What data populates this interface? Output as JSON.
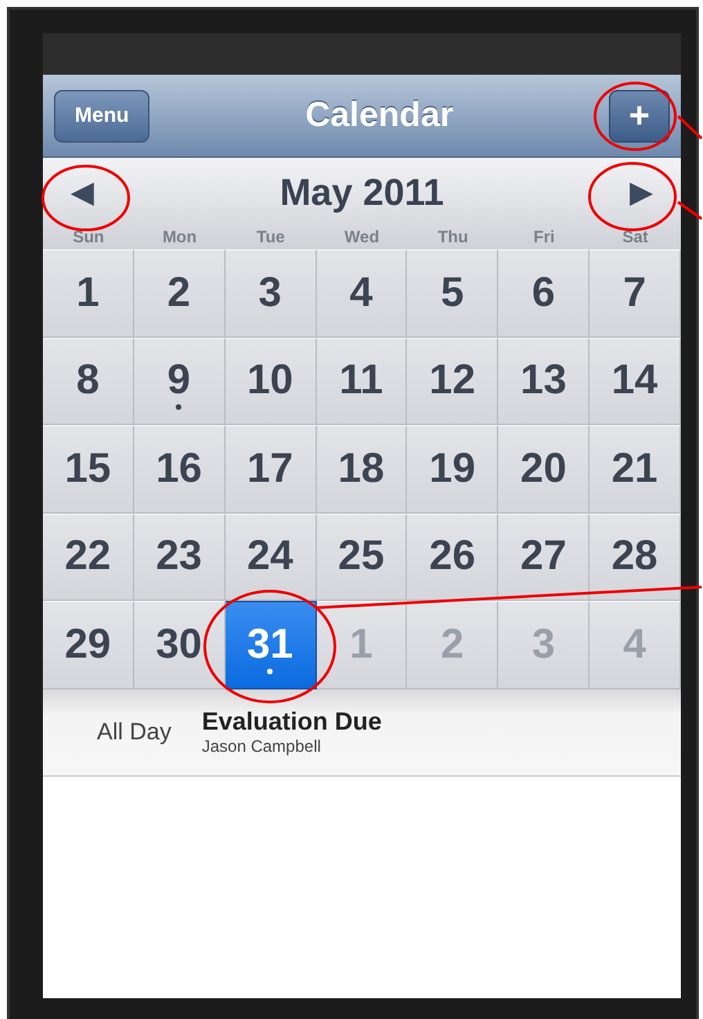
{
  "nav_bar": {
    "menu_button": "Menu",
    "title": "Calendar",
    "add_button": "+"
  },
  "month_header": {
    "prev_button": "◀",
    "title": "May 2011",
    "next_button": "▶"
  },
  "weekdays": [
    "Sun",
    "Mon",
    "Tue",
    "Wed",
    "Thu",
    "Fri",
    "Sat"
  ],
  "days": [
    {
      "label": "1",
      "in_month": true,
      "selected": false,
      "marked": false
    },
    {
      "label": "2",
      "in_month": true,
      "selected": false,
      "marked": false
    },
    {
      "label": "3",
      "in_month": true,
      "selected": false,
      "marked": false
    },
    {
      "label": "4",
      "in_month": true,
      "selected": false,
      "marked": false
    },
    {
      "label": "5",
      "in_month": true,
      "selected": false,
      "marked": false
    },
    {
      "label": "6",
      "in_month": true,
      "selected": false,
      "marked": false
    },
    {
      "label": "7",
      "in_month": true,
      "selected": false,
      "marked": false
    },
    {
      "label": "8",
      "in_month": true,
      "selected": false,
      "marked": false
    },
    {
      "label": "9",
      "in_month": true,
      "selected": false,
      "marked": true
    },
    {
      "label": "10",
      "in_month": true,
      "selected": false,
      "marked": false
    },
    {
      "label": "11",
      "in_month": true,
      "selected": false,
      "marked": false
    },
    {
      "label": "12",
      "in_month": true,
      "selected": false,
      "marked": false
    },
    {
      "label": "13",
      "in_month": true,
      "selected": false,
      "marked": false
    },
    {
      "label": "14",
      "in_month": true,
      "selected": false,
      "marked": false
    },
    {
      "label": "15",
      "in_month": true,
      "selected": false,
      "marked": false
    },
    {
      "label": "16",
      "in_month": true,
      "selected": false,
      "marked": false
    },
    {
      "label": "17",
      "in_month": true,
      "selected": false,
      "marked": false
    },
    {
      "label": "18",
      "in_month": true,
      "selected": false,
      "marked": false
    },
    {
      "label": "19",
      "in_month": true,
      "selected": false,
      "marked": false
    },
    {
      "label": "20",
      "in_month": true,
      "selected": false,
      "marked": false
    },
    {
      "label": "21",
      "in_month": true,
      "selected": false,
      "marked": false
    },
    {
      "label": "22",
      "in_month": true,
      "selected": false,
      "marked": false
    },
    {
      "label": "23",
      "in_month": true,
      "selected": false,
      "marked": false
    },
    {
      "label": "24",
      "in_month": true,
      "selected": false,
      "marked": false
    },
    {
      "label": "25",
      "in_month": true,
      "selected": false,
      "marked": false
    },
    {
      "label": "26",
      "in_month": true,
      "selected": false,
      "marked": false
    },
    {
      "label": "27",
      "in_month": true,
      "selected": false,
      "marked": false
    },
    {
      "label": "28",
      "in_month": true,
      "selected": false,
      "marked": false
    },
    {
      "label": "29",
      "in_month": true,
      "selected": false,
      "marked": false
    },
    {
      "label": "30",
      "in_month": true,
      "selected": false,
      "marked": false
    },
    {
      "label": "31",
      "in_month": true,
      "selected": true,
      "marked": true
    },
    {
      "label": "1",
      "in_month": false,
      "selected": false,
      "marked": false
    },
    {
      "label": "2",
      "in_month": false,
      "selected": false,
      "marked": false
    },
    {
      "label": "3",
      "in_month": false,
      "selected": false,
      "marked": false
    },
    {
      "label": "4",
      "in_month": false,
      "selected": false,
      "marked": false
    }
  ],
  "events": [
    {
      "time": "All Day",
      "title": "Evaluation Due",
      "person": "Jason Campbell"
    }
  ]
}
